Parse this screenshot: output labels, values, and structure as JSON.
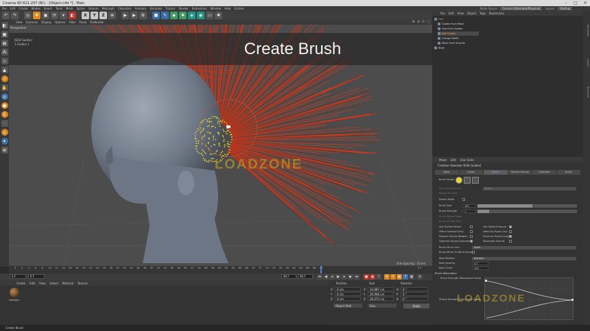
{
  "window": {
    "title": "Cinema 4D R21.207 (RC) - [Object.c4d *] - Main",
    "controls": [
      "–",
      "□",
      "✕"
    ]
  },
  "menubar": [
    "File",
    "Edit",
    "Create",
    "Modes",
    "Select",
    "Tools",
    "Mesh",
    "Spline",
    "Volume",
    "MoGraph",
    "Character",
    "Animate",
    "Simulate",
    "Tracker",
    "Render",
    "Extensions",
    "Window",
    "Help",
    "Octane"
  ],
  "layout": {
    "node_space_label": "Node Space:",
    "node_space_value": "Current (Standard/Physical)",
    "layout_label": "Layout:",
    "layout_value": "Startup"
  },
  "toolbar": {
    "axis_x": "X",
    "axis_y": "Y",
    "axis_z": "Z"
  },
  "viewport": {
    "menu": [
      "View",
      "Cameras",
      "Display",
      "Options",
      "Filter",
      "Panel",
      "ProRender"
    ],
    "camera": "Perspective",
    "info_line1": "[Edit Guides]",
    "info_line2": "1 Guides  1",
    "banner_text": "Create Brush",
    "grid_spacing": "Grid Spacing : 10 cm",
    "watermark": "LOADZONE"
  },
  "timeline": {
    "ticks": [
      "0",
      "2",
      "4",
      "6",
      "8",
      "10",
      "12",
      "14",
      "16",
      "18",
      "20",
      "22",
      "24",
      "26",
      "28",
      "30",
      "32",
      "34",
      "36",
      "38",
      "40",
      "42",
      "44",
      "46",
      "48",
      "50",
      "52",
      "54",
      "56",
      "58",
      "60",
      "62",
      "64",
      "66",
      "68",
      "70",
      "72",
      "74",
      "76",
      "78",
      "80",
      "82",
      "84",
      "86",
      "88",
      "90"
    ],
    "current_frame": "0 F"
  },
  "transport": {
    "start_frame": "0 F",
    "start_frame_2": "0 F",
    "end_frame": "90 F",
    "end_frame_2": "90 F"
  },
  "material_manager": {
    "menu": [
      "Create",
      "Edit",
      "View",
      "Select",
      "Material",
      "Texture"
    ],
    "material_name": "Hairlight"
  },
  "coordinates": {
    "headers": [
      "Position",
      "Size",
      "Rotation"
    ],
    "rows": [
      {
        "axis": "X",
        "pos": "0 cm",
        "size_axis": "X",
        "size": "34.887 cm",
        "rot_axis": "H",
        "rot": "0 °"
      },
      {
        "axis": "Y",
        "pos": "0 cm",
        "size_axis": "Y",
        "size": "26.968 cm",
        "rot_axis": "P",
        "rot": "0 °"
      },
      {
        "axis": "Z",
        "pos": "0 cm",
        "size_axis": "Z",
        "size": "36.072 cm",
        "rot_axis": "B",
        "rot": "0 °"
      }
    ],
    "mode": "Object (Rel)",
    "size_mode": "Size",
    "apply": "Apply"
  },
  "object_manager": {
    "menu": [
      "File",
      "Edit",
      "View",
      "Object",
      "Tags",
      "Bookmarks"
    ],
    "objects": [
      {
        "name": "Hair",
        "highlight": false
      },
      {
        "name": "Guides From Mesh",
        "highlight": false
      },
      {
        "name": "Hair From Guides",
        "highlight": false
      },
      {
        "name": "Edit Guides",
        "highlight": true
      },
      {
        "name": "Change Width",
        "highlight": false
      },
      {
        "name": "Mesh From Strands",
        "highlight": false
      },
      {
        "name": "Body",
        "highlight": false
      }
    ]
  },
  "side_tabs": [
    "Attributes",
    "Layers",
    "Structure"
  ],
  "attribute_manager": {
    "menu": [
      "Mode",
      "Edit",
      "User Data"
    ],
    "title": "Creation Operator [Edit Guides]",
    "tabs": [
      "Basic",
      "Coord.",
      "Object",
      "Shared Groups",
      "Channels",
      "Rules"
    ],
    "active_tab": "Object",
    "brush_shape_label": "Brush Shape",
    "use_surface_brush_label": "Use Surface Brush",
    "use_surface_brush_value": "Brush",
    "reload_brushes": "Reload Brushes",
    "elastic_mode": "Elastic Mode",
    "brush_size_label": "Brush Size",
    "brush_size_value": "100",
    "brush_size_fraction": 0.55,
    "brush_strength_label": "Brush Strength",
    "brush_strength_value": "1",
    "brush_strength_fraction": 0.12,
    "brush_stamp_label": "Brush Stamp Mode",
    "brush_stamp_value": "...",
    "brush_alt_label": "Brush alt Edit Slice",
    "checks_left": [
      {
        "label": "Use Surface Brush",
        "on": false
      },
      {
        "label": "Affect Selected Only",
        "on": false
      },
      {
        "label": "Respect Vertex Weights",
        "on": false
      },
      {
        "label": "Optimize Strand Geometry",
        "on": true
      }
    ],
    "checks_right": [
      {
        "label": "Use Tablet Pressure",
        "on": true
      },
      {
        "label": "Affect By Roots Only",
        "on": false
      },
      {
        "label": "Preserve Strand Length",
        "on": true
      },
      {
        "label": "Resample Strands",
        "on": false
      }
    ],
    "mirror_axis_label": "Brush Mirror Axis",
    "mirror_axis_value": "None",
    "mirror_world_label": "Brush Mirror In World Space",
    "root_position_label": "Root Position",
    "root_position_value": "Random",
    "root_spacing_label": "Root Spacing",
    "root_spacing_value": "0.2",
    "root_count_label": "Root Count",
    "root_count_value": "100",
    "brush_attenuation": "Brush Attenuation",
    "strength_ramp_label": "Brush Strength Attenuation Ramp",
    "strand_strength_label": "Strand Strength Attenuation Ramp",
    "watermark": "LOADZONE"
  },
  "status_bar": "Create Brush",
  "colors": {
    "accent_blue": "#4d8ad8",
    "hair_red": "#e03a1c",
    "guide_yellow": "#e6d631",
    "object_orange": "#e0a25a"
  }
}
